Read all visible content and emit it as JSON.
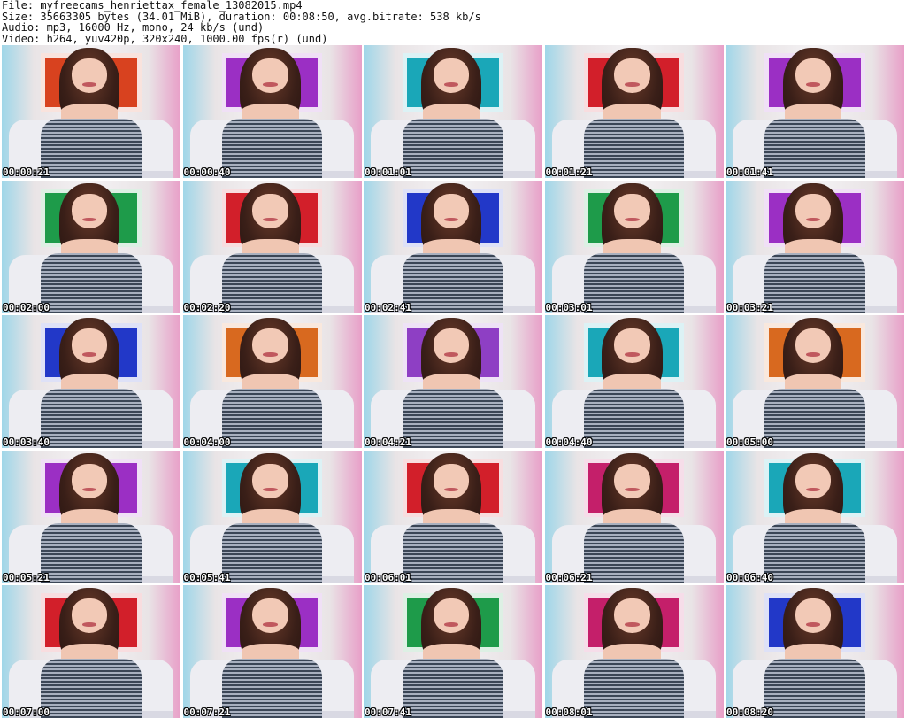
{
  "header": {
    "file": "File: myfreecams_henriettax_female_13082015.mp4",
    "size": "Size: 35663305 bytes (34.01 MiB), duration: 00:08:50, avg.bitrate: 538 kb/s",
    "audio": "Audio: mp3, 16000 Hz, mono, 24 kb/s (und)",
    "video": "Video: h264, yuv420p, 320x240, 1000.00 fps(r) (und)"
  },
  "thumbnails": [
    {
      "timestamp": "00:00:21",
      "panel_color": "#d8421f"
    },
    {
      "timestamp": "00:00:40",
      "panel_color": "#9b2fc4"
    },
    {
      "timestamp": "00:01:01",
      "panel_color": "#1aa7b8"
    },
    {
      "timestamp": "00:01:21",
      "panel_color": "#d21f2a"
    },
    {
      "timestamp": "00:01:41",
      "panel_color": "#9b2fc4"
    },
    {
      "timestamp": "00:02:00",
      "panel_color": "#1e9b4a"
    },
    {
      "timestamp": "00:02:20",
      "panel_color": "#d21f2a"
    },
    {
      "timestamp": "00:02:41",
      "panel_color": "#2238c8"
    },
    {
      "timestamp": "00:03:01",
      "panel_color": "#1e9b4a"
    },
    {
      "timestamp": "00:03:21",
      "panel_color": "#9b2fc4"
    },
    {
      "timestamp": "00:03:40",
      "panel_color": "#2238c8"
    },
    {
      "timestamp": "00:04:00",
      "panel_color": "#d8691f"
    },
    {
      "timestamp": "00:04:21",
      "panel_color": "#8e3fc4"
    },
    {
      "timestamp": "00:04:40",
      "panel_color": "#1aa7b8"
    },
    {
      "timestamp": "00:05:00",
      "panel_color": "#d8691f"
    },
    {
      "timestamp": "00:05:21",
      "panel_color": "#9b2fc4"
    },
    {
      "timestamp": "00:05:41",
      "panel_color": "#1aa7b8"
    },
    {
      "timestamp": "00:06:01",
      "panel_color": "#d21f2a"
    },
    {
      "timestamp": "00:06:21",
      "panel_color": "#c41f6a"
    },
    {
      "timestamp": "00:06:40",
      "panel_color": "#1aa7b8"
    },
    {
      "timestamp": "00:07:00",
      "panel_color": "#d21f2a"
    },
    {
      "timestamp": "00:07:21",
      "panel_color": "#9b2fc4"
    },
    {
      "timestamp": "00:07:41",
      "panel_color": "#1e9b4a"
    },
    {
      "timestamp": "00:08:01",
      "panel_color": "#c41f6a"
    },
    {
      "timestamp": "00:08:20",
      "panel_color": "#2238c8"
    }
  ]
}
